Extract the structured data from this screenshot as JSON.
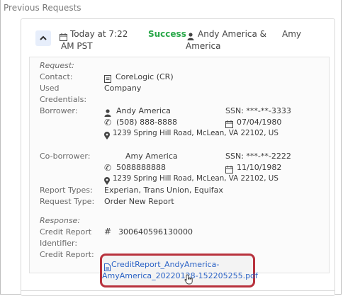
{
  "section": {
    "title": "Previous Requests"
  },
  "request_header": {
    "time_line1": "Today at 7:22",
    "time_line2": "AM PST",
    "status": "Success",
    "names_line1": "Andy America &",
    "names_line1b": "Amy",
    "names_line2": "America"
  },
  "labels": {
    "request": "Request:",
    "contact": "Contact:",
    "used_credentials_1": "Used",
    "used_credentials_2": "Credentials:",
    "borrower": "Borrower:",
    "coborrower": "Co-borrower:",
    "report_types": "Report Types:",
    "request_type": "Request Type:",
    "response": "Response:",
    "credit_report_identifier_1": "Credit Report",
    "credit_report_identifier_2": "Identifier:",
    "credit_report": "Credit Report:"
  },
  "values": {
    "contact": "CoreLogic (CR)",
    "used_credentials": "Company",
    "borrower": {
      "name": "Andy America",
      "ssn": "SSN: ***-**-3333",
      "phone": "(508) 888-8888",
      "dob": "07/04/1980",
      "address": "1239 Spring Hill Road, McLean, VA 22102, US"
    },
    "coborrower": {
      "name": "Amy America",
      "ssn": "SSN: ***-**-2222",
      "phone": "5088888888",
      "dob": "11/10/1982",
      "address": "1239 Spring Hill Road, McLean, VA 22102, US"
    },
    "report_types": "Experian, Trans Union, Equifax",
    "request_type": "Order New Report",
    "credit_report_identifier": "300640596130000",
    "credit_report_file_line1": "CreditReport_AndyAmerica-",
    "credit_report_file_line2": "AmyAmerica_20220128-152205255.pdf"
  },
  "colors": {
    "success": "#2aa84a",
    "link": "#2b63c6",
    "highlight_border": "#b8323d"
  }
}
